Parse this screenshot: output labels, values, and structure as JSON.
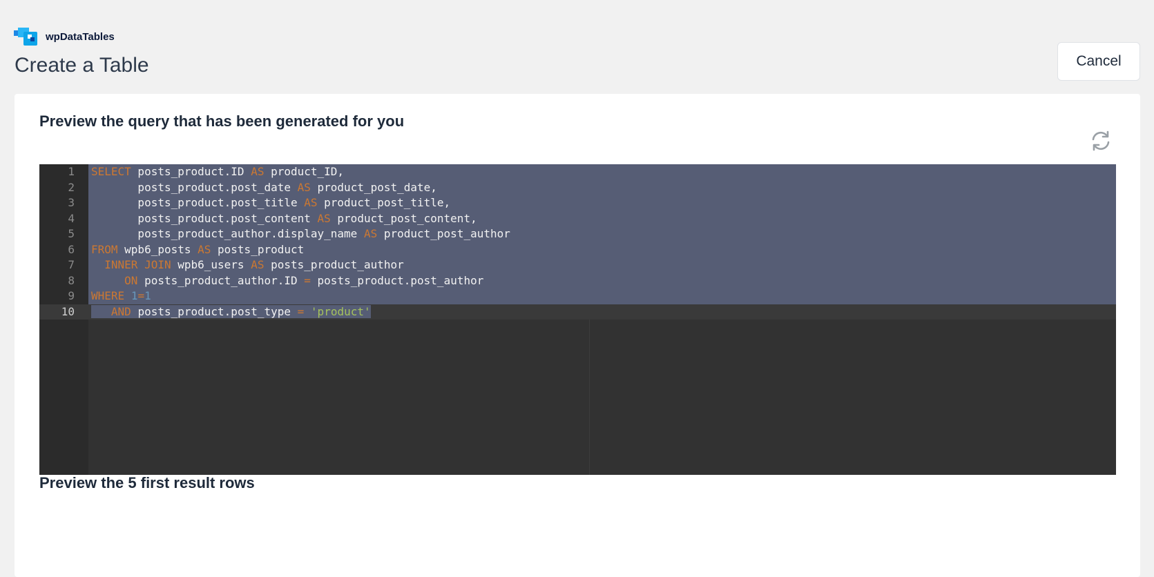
{
  "header": {
    "brand_name": "wpDataTables",
    "page_title": "Create a Table",
    "cancel_label": "Cancel"
  },
  "query_section": {
    "title": "Preview the query that has been generated for you",
    "refresh_icon": "refresh-icon",
    "editor": {
      "line_numbers": [
        "1",
        "2",
        "3",
        "4",
        "5",
        "6",
        "7",
        "8",
        "9",
        "10"
      ],
      "lines": [
        [
          {
            "t": "SELECT",
            "c": "kw"
          },
          {
            "t": " posts_product.ID ",
            "c": ""
          },
          {
            "t": "AS",
            "c": "kw"
          },
          {
            "t": " product_ID,",
            "c": ""
          }
        ],
        [
          {
            "t": "       posts_product.post_date ",
            "c": ""
          },
          {
            "t": "AS",
            "c": "kw"
          },
          {
            "t": " product_post_date,",
            "c": ""
          }
        ],
        [
          {
            "t": "       posts_product.post_title ",
            "c": ""
          },
          {
            "t": "AS",
            "c": "kw"
          },
          {
            "t": " product_post_title,",
            "c": ""
          }
        ],
        [
          {
            "t": "       posts_product.post_content ",
            "c": ""
          },
          {
            "t": "AS",
            "c": "kw"
          },
          {
            "t": " product_post_content,",
            "c": ""
          }
        ],
        [
          {
            "t": "       posts_product_author.display_name ",
            "c": ""
          },
          {
            "t": "AS",
            "c": "kw"
          },
          {
            "t": " product_post_author",
            "c": ""
          }
        ],
        [
          {
            "t": "FROM",
            "c": "kw"
          },
          {
            "t": " wpb6_posts ",
            "c": ""
          },
          {
            "t": "AS",
            "c": "kw"
          },
          {
            "t": " posts_product",
            "c": ""
          }
        ],
        [
          {
            "t": "  ",
            "c": ""
          },
          {
            "t": "INNER JOIN",
            "c": "kw"
          },
          {
            "t": " wpb6_users ",
            "c": ""
          },
          {
            "t": "AS",
            "c": "kw"
          },
          {
            "t": " posts_product_author",
            "c": ""
          }
        ],
        [
          {
            "t": "     ",
            "c": ""
          },
          {
            "t": "ON",
            "c": "kw"
          },
          {
            "t": " posts_product_author.ID ",
            "c": ""
          },
          {
            "t": "=",
            "c": "op"
          },
          {
            "t": " posts_product.post_author",
            "c": ""
          }
        ],
        [
          {
            "t": "WHERE",
            "c": "kw"
          },
          {
            "t": " ",
            "c": ""
          },
          {
            "t": "1",
            "c": "numlit"
          },
          {
            "t": "=",
            "c": "op"
          },
          {
            "t": "1",
            "c": "numlit"
          }
        ],
        [
          {
            "t": "   ",
            "c": ""
          },
          {
            "t": "AND",
            "c": "kw"
          },
          {
            "t": " posts_product.post_type ",
            "c": ""
          },
          {
            "t": "=",
            "c": "op"
          },
          {
            "t": " ",
            "c": ""
          },
          {
            "t": "'product'",
            "c": "str"
          }
        ]
      ]
    }
  },
  "results_section": {
    "title": "Preview the 5 first result rows"
  },
  "colors": {
    "keyword": "#cc7832",
    "string": "#a5c25c",
    "number": "#6897bb",
    "selection": "#565d75",
    "editor_bg": "#323232"
  }
}
